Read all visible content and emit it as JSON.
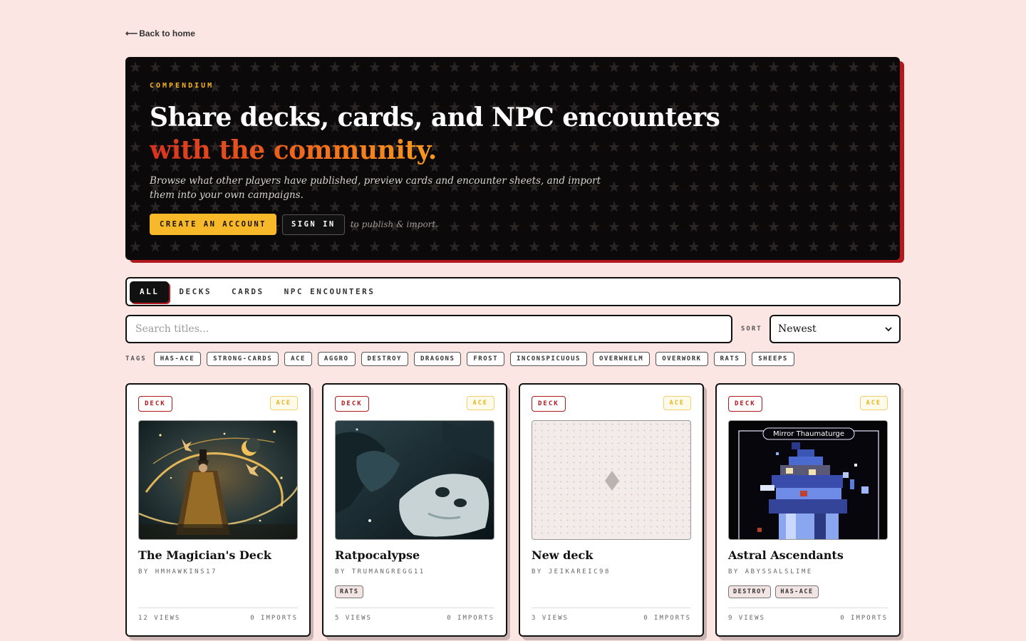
{
  "back_link": {
    "arrow": "⟵",
    "label": "Back to home"
  },
  "hero": {
    "eyebrow": "COMPENDIUM",
    "title_line1": "Share decks, cards, and NPC encounters",
    "title_line2": "with the community.",
    "lede": "Browse what other players have published, preview cards and encounter sheets, and import them into your own campaigns.",
    "create_account": "CREATE AN ACCOUNT",
    "sign_in": "SIGN IN",
    "note": "to publish & import."
  },
  "tabs": [
    {
      "label": "ALL",
      "active": true
    },
    {
      "label": "DECKS",
      "active": false
    },
    {
      "label": "CARDS",
      "active": false
    },
    {
      "label": "NPC ENCOUNTERS",
      "active": false
    }
  ],
  "search": {
    "placeholder": "Search titles..."
  },
  "sort": {
    "label": "SORT",
    "value": "Newest"
  },
  "tags": {
    "label": "TAGS",
    "items": [
      "HAS-ACE",
      "STRONG-CARDS",
      "ACE",
      "AGGRO",
      "DESTROY",
      "DRAGONS",
      "FROST",
      "INCONSPICUOUS",
      "OVERWHELM",
      "OVERWORK",
      "RATS",
      "SHEEPS"
    ]
  },
  "cards": [
    {
      "type": "DECK",
      "badge": "ACE",
      "title": "The Magician's Deck",
      "by": "BY HMHAWKINS17",
      "tags": [],
      "views": "12 VIEWS",
      "imports": "0 IMPORTS",
      "art": "magician"
    },
    {
      "type": "DECK",
      "badge": "ACE",
      "title": "Ratpocalypse",
      "by": "BY TRUMANGREGG11",
      "tags": [
        "RATS"
      ],
      "views": "5 VIEWS",
      "imports": "0 IMPORTS",
      "art": "rats"
    },
    {
      "type": "DECK",
      "badge": "ACE",
      "title": "New deck",
      "by": "BY JEIKAREIC98",
      "tags": [],
      "views": "3 VIEWS",
      "imports": "0 IMPORTS",
      "art": "placeholder"
    },
    {
      "type": "DECK",
      "badge": "ACE",
      "title": "Astral Ascendants",
      "by": "BY ABYSSALSLIME",
      "tags": [
        "DESTROY",
        "HAS-ACE"
      ],
      "views": "9 VIEWS",
      "imports": "0 IMPORTS",
      "art": "thaumaturge",
      "art_caption": "Mirror Thaumaturge"
    }
  ],
  "colors": {
    "page_bg": "#fbe6e4",
    "accent_red": "#b3181f",
    "accent_gold": "#f7b82a",
    "hero_bg": "#0b0909"
  }
}
